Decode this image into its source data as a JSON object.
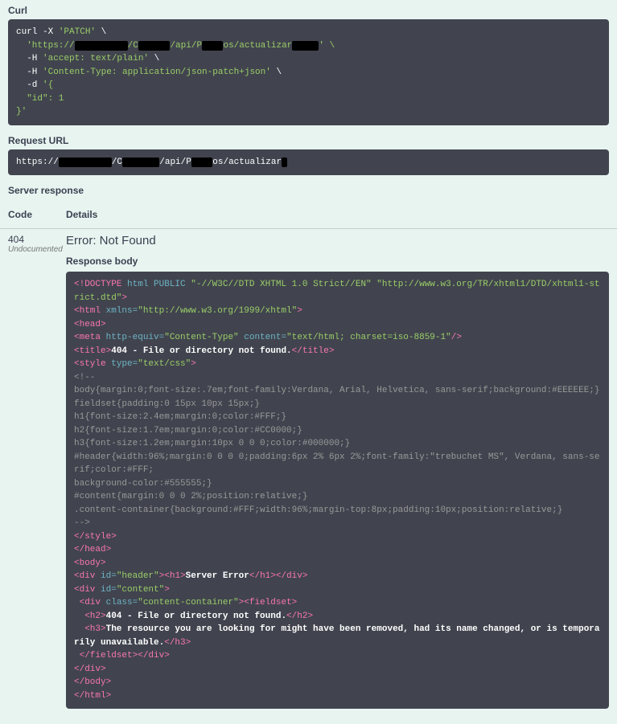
{
  "curl": {
    "label": "Curl",
    "l1a": "curl -X ",
    "l1b": "'PATCH'",
    "l1c": " \\",
    "l2a": "  'https://",
    "l2r1": "xxx xxx xx",
    "l2b": "/C",
    "l2r2": "xxxxxx",
    "l2c": "/api/P",
    "l2r3": "xxxx",
    "l2d": "os/actualizar",
    "l2r4": "xxxxx",
    "l2e": "' \\",
    "l3a": "  -H ",
    "l3b": "'accept: text/plain'",
    "l3c": " \\",
    "l4a": "  -H ",
    "l4b": "'Content-Type: application/json-patch+json'",
    "l4c": " \\",
    "l5a": "  -d ",
    "l5b": "'{",
    "l6": "  \"id\": 1",
    "l7": "}'"
  },
  "requrl": {
    "label": "Request URL",
    "p1": "https://",
    "r1": "xxx xxx xx",
    "p2": "/C",
    "r2": "xxxxxxx",
    "p3": "/api/P",
    "r3": "xxxx",
    "p4": "os/actualizar",
    "r4": "x"
  },
  "server_label": "Server response",
  "code_hdr": "Code",
  "details_hdr": "Details",
  "code404": "404",
  "undoc": "Undocumented",
  "err": "Error: Not Found",
  "resp_label": "Response body",
  "r": {
    "a1": "<!DOCTYPE ",
    "a2": "html ",
    "a3": "PUBLIC ",
    "a4": "\"-//W3C//DTD XHTML 1.0 Strict//EN\" \"http://www.w3.org/TR/xhtml1/DTD/xhtml1-strict.dtd\"",
    "a5": ">",
    "b1": "<html ",
    "b2": "xmlns=",
    "b3": "\"http://www.w3.org/1999/xhtml\"",
    "b4": ">",
    "c1": "<head>",
    "d1": "<meta ",
    "d2": "http-equiv=",
    "d3": "\"Content-Type\"",
    "d4": " content=",
    "d5": "\"text/html; charset=iso-8859-1\"",
    "d6": "/>",
    "e1": "<title>",
    "e2": "404 - File or directory not found.",
    "e3": "</title>",
    "f1": "<style ",
    "f2": "type=",
    "f3": "\"text/css\"",
    "f4": ">",
    "g1": "<!--",
    "g2": "body{margin:0;font-size:.7em;font-family:Verdana, Arial, Helvetica, sans-serif;background:#EEEEEE;}",
    "g3": "fieldset{padding:0 15px 10px 15px;}",
    "g4": "h1{font-size:2.4em;margin:0;color:#FFF;}",
    "g5": "h2{font-size:1.7em;margin:0;color:#CC0000;}",
    "g6": "h3{font-size:1.2em;margin:10px 0 0 0;color:#000000;}",
    "g7": "#header{width:96%;margin:0 0 0 0;padding:6px 2% 6px 2%;font-family:\"trebuchet MS\", Verdana, sans-serif;color:#FFF;",
    "g8": "background-color:#555555;}",
    "g9": "#content{margin:0 0 0 2%;position:relative;}",
    "g10": ".content-container{background:#FFF;width:96%;margin-top:8px;padding:10px;position:relative;}",
    "g11": "-->",
    "h1": "</style>",
    "h2": "</head>",
    "h3": "<body>",
    "i1": "<div ",
    "i2": "id=",
    "i3": "\"header\"",
    "i4": "><h1>",
    "i5": "Server Error",
    "i6": "</h1></div>",
    "j1": "<div ",
    "j2": "id=",
    "j3": "\"content\"",
    "j4": ">",
    "k1": " <div ",
    "k2": "class=",
    "k3": "\"content-container\"",
    "k4": "><fieldset>",
    "l1": "  <h2>",
    "l2": "404 - File or directory not found.",
    "l3": "</h2>",
    "m1": "  <h3>",
    "m2": "The resource you are looking for might have been removed, had its name changed, or is temporarily unavailable.",
    "m3": "</h3>",
    "n1": " </fieldset></div>",
    "n2": "</div>",
    "n3": "</body>",
    "n4": "</html>"
  }
}
